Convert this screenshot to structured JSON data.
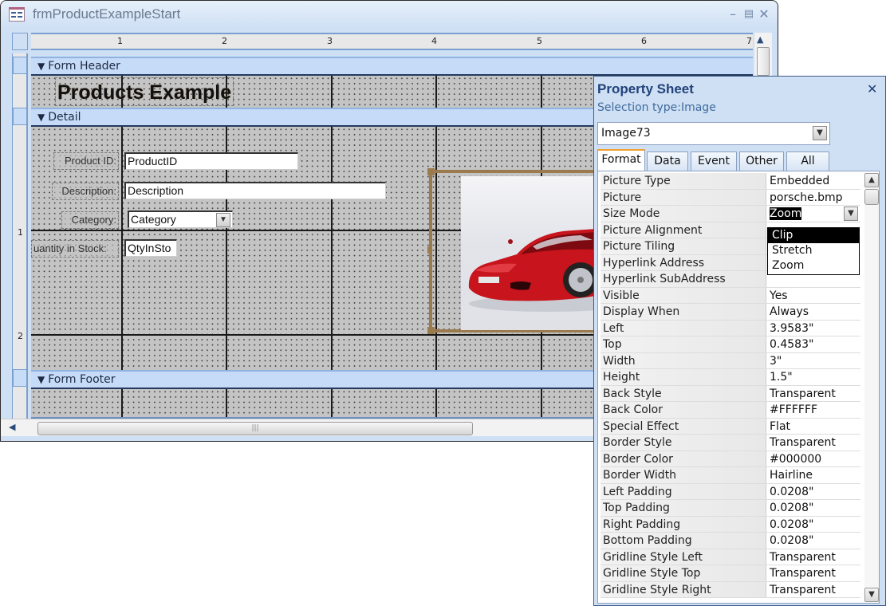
{
  "window": {
    "title": "frmProductExampleStart",
    "minimize_icon": "minimize-icon",
    "maximize_icon": "maximize-icon",
    "close_icon": "close-icon"
  },
  "ruler": {
    "horizontal_labels": [
      "1",
      "2",
      "3",
      "4",
      "5",
      "6",
      "7"
    ],
    "vertical_labels": [
      "1",
      "2"
    ]
  },
  "sections": {
    "form_header": "Form Header",
    "detail": "Detail",
    "form_footer": "Form Footer"
  },
  "form": {
    "heading": "Products Example",
    "fields": [
      {
        "label": "Product ID:",
        "control": "ProductID",
        "type": "textbox"
      },
      {
        "label": "Description:",
        "control": "Description",
        "type": "textbox"
      },
      {
        "label": "Category:",
        "control": "Category",
        "type": "combobox"
      },
      {
        "label": "uantity in Stock:",
        "control": "QtyInSto",
        "type": "textbox"
      }
    ],
    "image_control": "Image73"
  },
  "property_sheet": {
    "title": "Property Sheet",
    "selection_type": "Selection type:Image",
    "selected_object": "Image73",
    "tabs": [
      "Format",
      "Data",
      "Event",
      "Other",
      "All"
    ],
    "active_tab": "Format",
    "properties": [
      {
        "name": "Picture Type",
        "value": "Embedded"
      },
      {
        "name": "Picture",
        "value": "porsche.bmp"
      },
      {
        "name": "Size Mode",
        "value": "Zoom"
      },
      {
        "name": "Picture Alignment",
        "value": ""
      },
      {
        "name": "Picture Tiling",
        "value": ""
      },
      {
        "name": "Hyperlink Address",
        "value": ""
      },
      {
        "name": "Hyperlink SubAddress",
        "value": ""
      },
      {
        "name": "Visible",
        "value": "Yes"
      },
      {
        "name": "Display When",
        "value": "Always"
      },
      {
        "name": "Left",
        "value": "3.9583\""
      },
      {
        "name": "Top",
        "value": "0.4583\""
      },
      {
        "name": "Width",
        "value": "3\""
      },
      {
        "name": "Height",
        "value": "1.5\""
      },
      {
        "name": "Back Style",
        "value": "Transparent"
      },
      {
        "name": "Back Color",
        "value": "#FFFFFF"
      },
      {
        "name": "Special Effect",
        "value": "Flat"
      },
      {
        "name": "Border Style",
        "value": "Transparent"
      },
      {
        "name": "Border Color",
        "value": "#000000"
      },
      {
        "name": "Border Width",
        "value": "Hairline"
      },
      {
        "name": "Left Padding",
        "value": "0.0208\""
      },
      {
        "name": "Top Padding",
        "value": "0.0208\""
      },
      {
        "name": "Right Padding",
        "value": "0.0208\""
      },
      {
        "name": "Bottom Padding",
        "value": "0.0208\""
      },
      {
        "name": "Gridline Style Left",
        "value": "Transparent"
      },
      {
        "name": "Gridline Style Top",
        "value": "Transparent"
      },
      {
        "name": "Gridline Style Right",
        "value": "Transparent"
      }
    ],
    "size_mode_dropdown": {
      "options": [
        "Clip",
        "Stretch",
        "Zoom"
      ],
      "highlighted": "Clip"
    }
  },
  "colors": {
    "section_bar": "#c5dbf7",
    "grid_background": "#c4c4c4",
    "selection_frame": "#9b7b4d",
    "property_sheet_title": "#21427a"
  }
}
